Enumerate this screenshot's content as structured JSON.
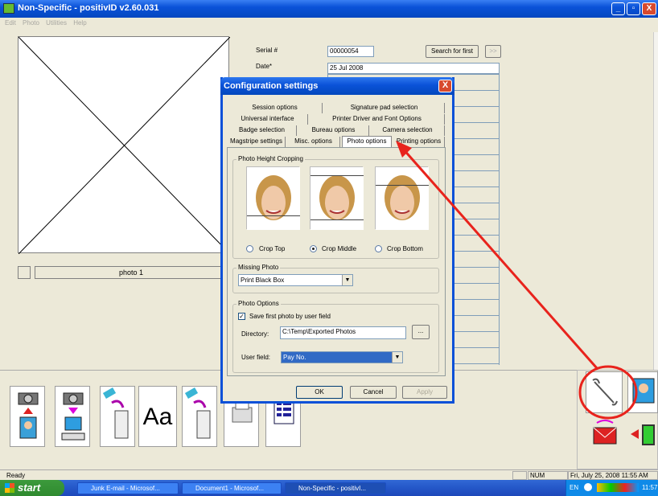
{
  "window": {
    "title": "Non-Specific - positivID v2.60.031",
    "minimize_glyph": "_",
    "maximize_glyph": "▫",
    "close_glyph": "X"
  },
  "menu": [
    "Edit",
    "Photo",
    "Utilities",
    "Help"
  ],
  "record": {
    "serial_label": "Serial #",
    "serial_value": "00000054",
    "search_first_label": "Search for first",
    "next_glyph": ">>",
    "date_label": "Date*",
    "date_value": "25 Jul 2008",
    "photo_label": "photo 1"
  },
  "dialog": {
    "title": "Configuration settings",
    "close_glyph": "X",
    "tabs_row1": [
      "Session options",
      "Signature pad selection"
    ],
    "tabs_row2": [
      "Universal interface",
      "Printer Driver and Font Options"
    ],
    "tabs_row3": [
      "Badge selection",
      "Bureau options",
      "Camera selection"
    ],
    "tabs_row4": [
      "Magstripe settings",
      "Misc. options",
      "Photo options",
      "Printing options"
    ],
    "selected_tab": "Photo options",
    "crop_group": "Photo Height Cropping",
    "crop_options": [
      "Crop Top",
      "Crop Middle",
      "Crop Bottom"
    ],
    "crop_selected": "Crop Middle",
    "missing_group": "Missing Photo",
    "missing_value": "Print Black Box",
    "options_group": "Photo Options",
    "save_first_label": "Save first photo by user field",
    "save_first_checked": true,
    "directory_label": "Directory:",
    "directory_value": "C:\\Temp\\Exported Photos",
    "browse_label": "...",
    "user_field_label": "User field:",
    "user_field_value": "Pay No.",
    "ok_label": "OK",
    "cancel_label": "Cancel",
    "apply_label": "Apply"
  },
  "toolbar": {
    "text_tool_label": "Aa"
  },
  "status": {
    "text": "Ready",
    "num": "NUM",
    "datetime": "Fri, July 25, 2008  11:55 AM"
  },
  "taskbar": {
    "start": "start",
    "items": [
      "Junk E-mail - Microsof...",
      "Document1 - Microsof...",
      "Non-Specific - positivI..."
    ],
    "lang": "EN",
    "clock": "11:57"
  },
  "annotation_color": "#e8231c"
}
